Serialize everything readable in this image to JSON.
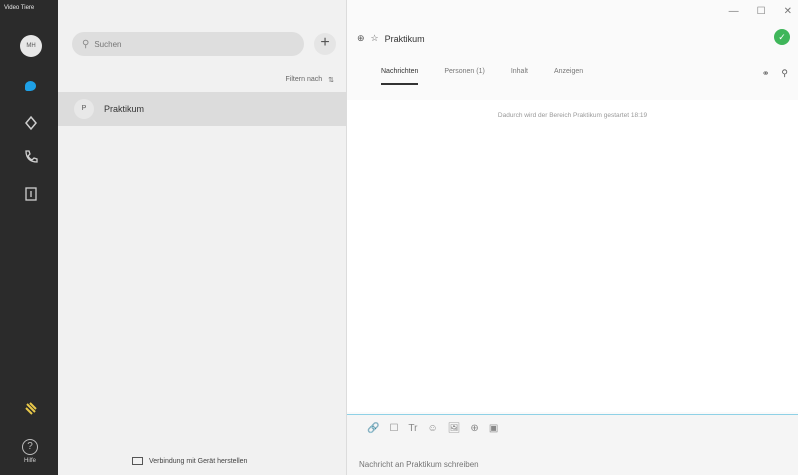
{
  "rail": {
    "brand": "Video Tiere",
    "avatar": "MH",
    "help_label": "Hilfe"
  },
  "search": {
    "placeholder": "Suchen"
  },
  "list": {
    "filter_label": "Filtern nach",
    "filter_icon": "⇅",
    "conversations": [
      {
        "initial": "P",
        "name": "Praktikum"
      }
    ]
  },
  "connect_label": "Verbindung mit Gerät herstellen",
  "chat": {
    "title": "Praktikum",
    "tabs": [
      "Nachrichten",
      "Personen (1)",
      "Inhalt",
      "Anzeigen"
    ],
    "system_message": "Dadurch wird der Bereich Praktikum gestartet 18:19",
    "composer_placeholder": "Nachricht an Praktikum schreiben",
    "format_icons": [
      "🔗",
      "☐",
      "Tr",
      "☺",
      "🖼",
      "⊕",
      "▣"
    ]
  },
  "colors": {
    "rail_bg": "#2b2b2b",
    "accent": "#1ea0e6",
    "status": "#3fb65a"
  }
}
